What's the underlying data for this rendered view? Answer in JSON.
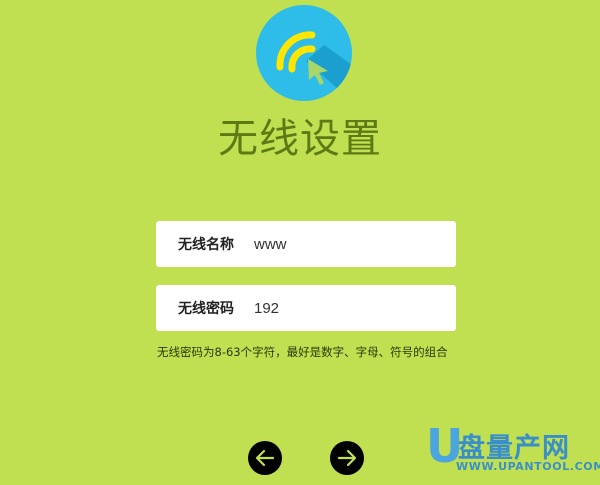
{
  "header": {
    "title": "无线设置",
    "logo_icon": "wifi-cursor-icon",
    "logo_color": "#2dbde8"
  },
  "form": {
    "ssid": {
      "label": "无线名称",
      "value": "www"
    },
    "password": {
      "label": "无线密码",
      "value": "192"
    },
    "hint": "无线密码为8-63个字符，最好是数字、字母、符号的组合"
  },
  "nav": {
    "prev_icon": "arrow-left-icon",
    "next_icon": "arrow-right-icon"
  },
  "watermark": {
    "letter": "U",
    "brand": "盘量产网",
    "url": "WWW.UPANTOOL.COM"
  },
  "colors": {
    "background": "#c0e052",
    "title": "#5d7a14"
  }
}
